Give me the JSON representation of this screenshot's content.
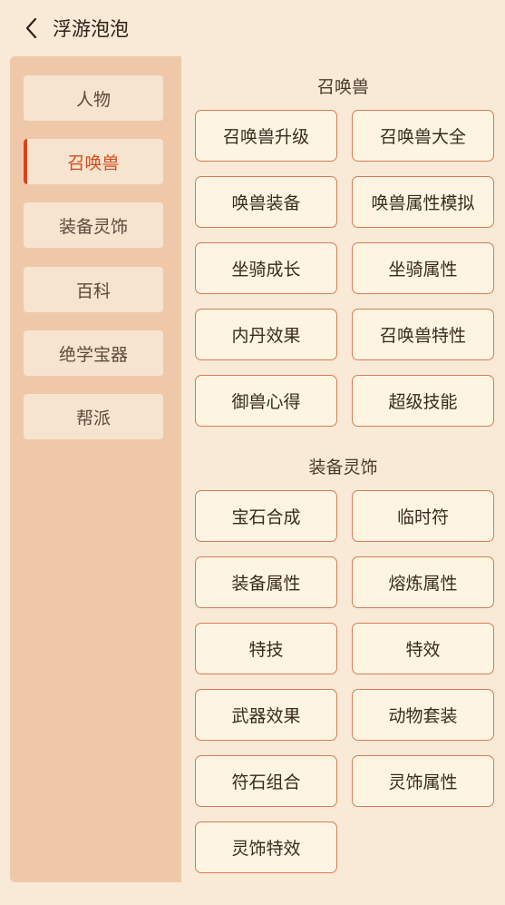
{
  "header": {
    "title": "浮游泡泡"
  },
  "sidebar": {
    "items": [
      {
        "label": "人物",
        "active": false
      },
      {
        "label": "召唤兽",
        "active": true
      },
      {
        "label": "装备灵饰",
        "active": false
      },
      {
        "label": "百科",
        "active": false
      },
      {
        "label": "绝学宝器",
        "active": false
      },
      {
        "label": "帮派",
        "active": false
      }
    ]
  },
  "sections": [
    {
      "title": "召唤兽",
      "buttons": [
        "召唤兽升级",
        "召唤兽大全",
        "唤兽装备",
        "唤兽属性模拟",
        "坐骑成长",
        "坐骑属性",
        "内丹效果",
        "召唤兽特性",
        "御兽心得",
        "超级技能"
      ]
    },
    {
      "title": "装备灵饰",
      "buttons": [
        "宝石合成",
        "临时符",
        "装备属性",
        "熔炼属性",
        "特技",
        "特效",
        "武器效果",
        "动物套装",
        "符石组合",
        "灵饰属性",
        "灵饰特效"
      ]
    }
  ],
  "colors": {
    "accent": "#d8431a",
    "sidebar_bg": "#efc8aa",
    "button_border": "#d97a55",
    "page_bg": "#f8ead6"
  }
}
